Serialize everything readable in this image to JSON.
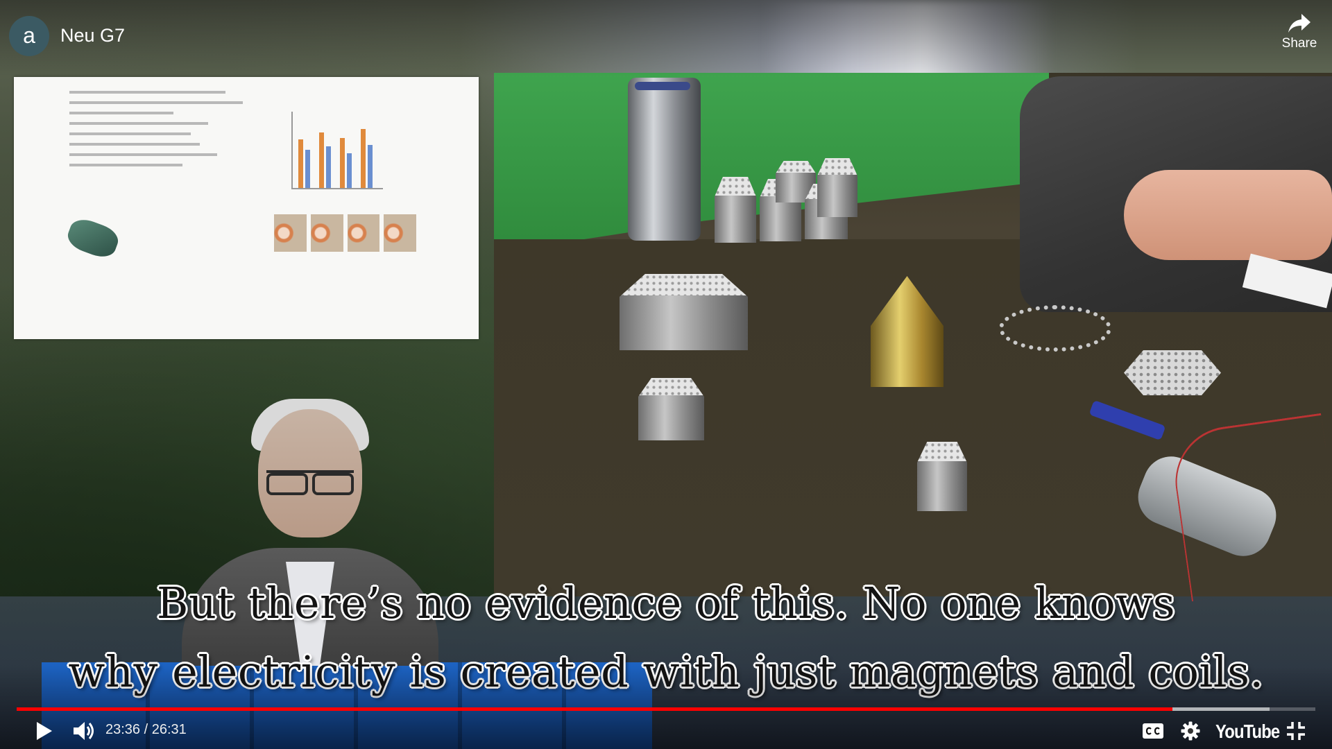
{
  "channel": {
    "avatar_letter": "a"
  },
  "video": {
    "title": "Neu G7"
  },
  "top_bar": {
    "share_label": "Share"
  },
  "captions": {
    "line1": "But there’s no evidence of this. No one knows",
    "line2": "why electricity is created with just magnets and coils."
  },
  "player": {
    "current_time": "23:36",
    "duration": "26:31",
    "time_display": "23:36 / 26:31",
    "played_fraction": 0.89,
    "buffered_fraction": 0.965,
    "logo_text": "YouTube",
    "accent_color": "#ff0000"
  },
  "icons": {
    "play": "play-icon",
    "volume": "volume-icon",
    "captions": "closed-captions-icon",
    "settings": "gear-icon",
    "exit_fullscreen": "exit-fullscreen-icon",
    "share": "share-arrow-icon"
  }
}
